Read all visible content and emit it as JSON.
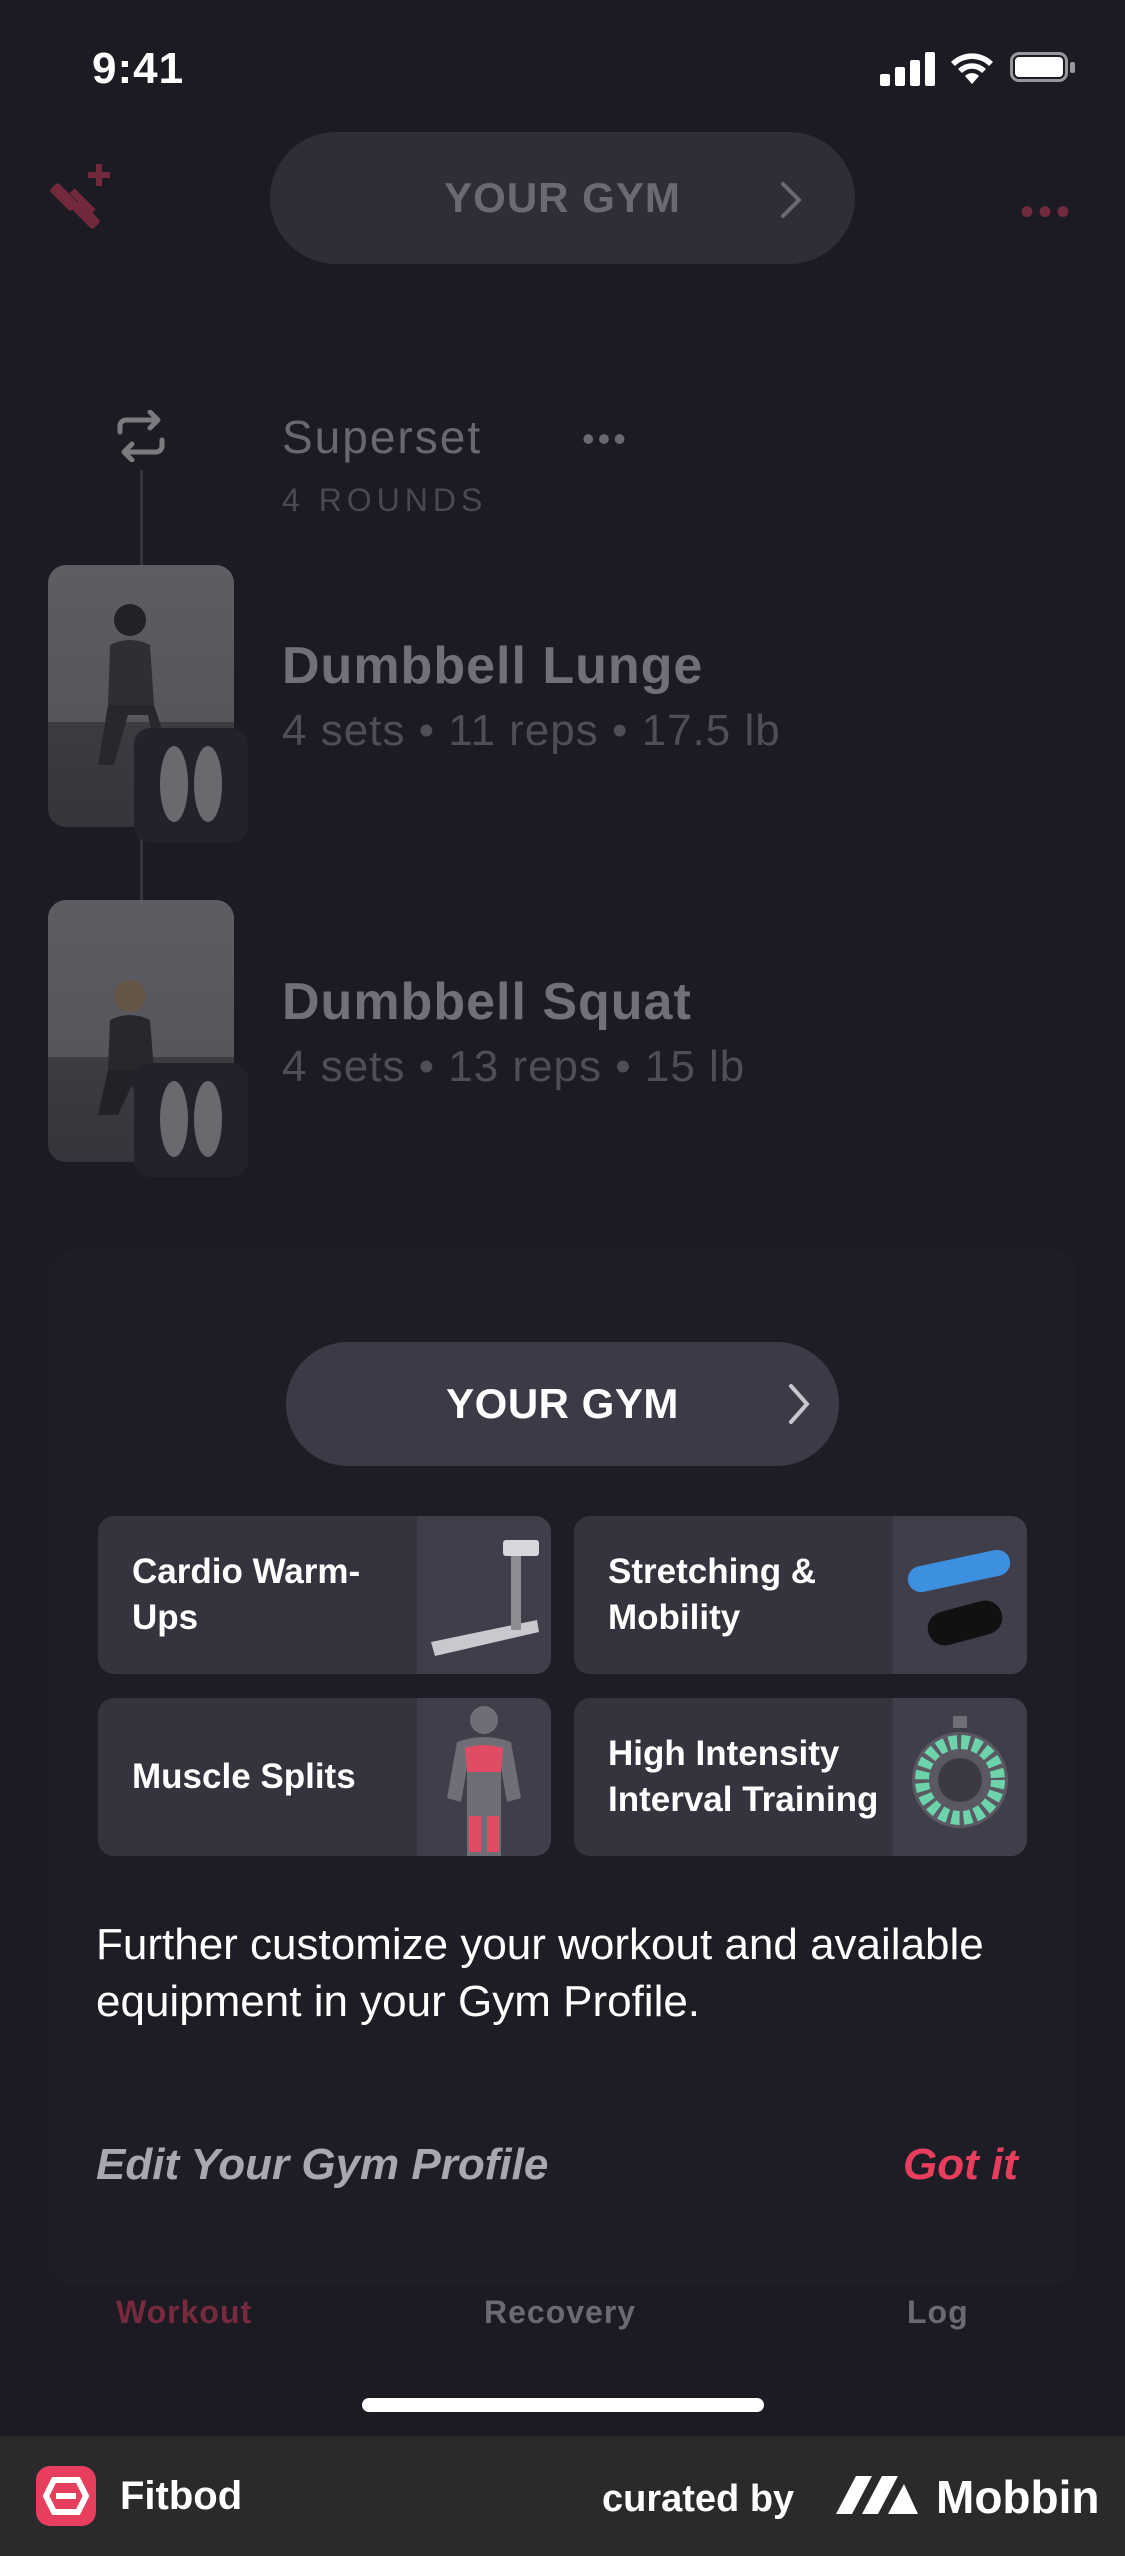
{
  "status": {
    "time": "9:41"
  },
  "topbar": {
    "gym_label": "YOUR GYM"
  },
  "superset": {
    "title": "Superset",
    "rounds": "4 ROUNDS",
    "exercises": [
      {
        "name": "Dumbbell Lunge",
        "detail": "4 sets • 11 reps • 17.5 lb"
      },
      {
        "name": "Dumbbell Squat",
        "detail": "4 sets • 13 reps • 15 lb"
      }
    ]
  },
  "card": {
    "gym_button": "YOUR GYM",
    "tiles": [
      {
        "label": "Cardio Warm-Ups",
        "icon": "treadmill-icon"
      },
      {
        "label": "Stretching & Mobility",
        "icon": "foam-roller-icon"
      },
      {
        "label": "Muscle Splits",
        "icon": "muscle-body-icon"
      },
      {
        "label": "High Intensity Interval Training",
        "icon": "stopwatch-icon"
      }
    ],
    "description": "Further customize your workout and available equipment in your Gym Profile.",
    "edit_link": "Edit Your Gym Profile",
    "got_it": "Got it"
  },
  "tabs": [
    {
      "label": "Workout",
      "active": true
    },
    {
      "label": "Recovery",
      "active": false
    },
    {
      "label": "Log",
      "active": false
    }
  ],
  "footer": {
    "app_name": "Fitbod",
    "curated_by": "curated by",
    "brand": "Mobbin"
  },
  "colors": {
    "accent": "#e63e5c",
    "background": "#1c1b24",
    "tile": "#34333e"
  }
}
